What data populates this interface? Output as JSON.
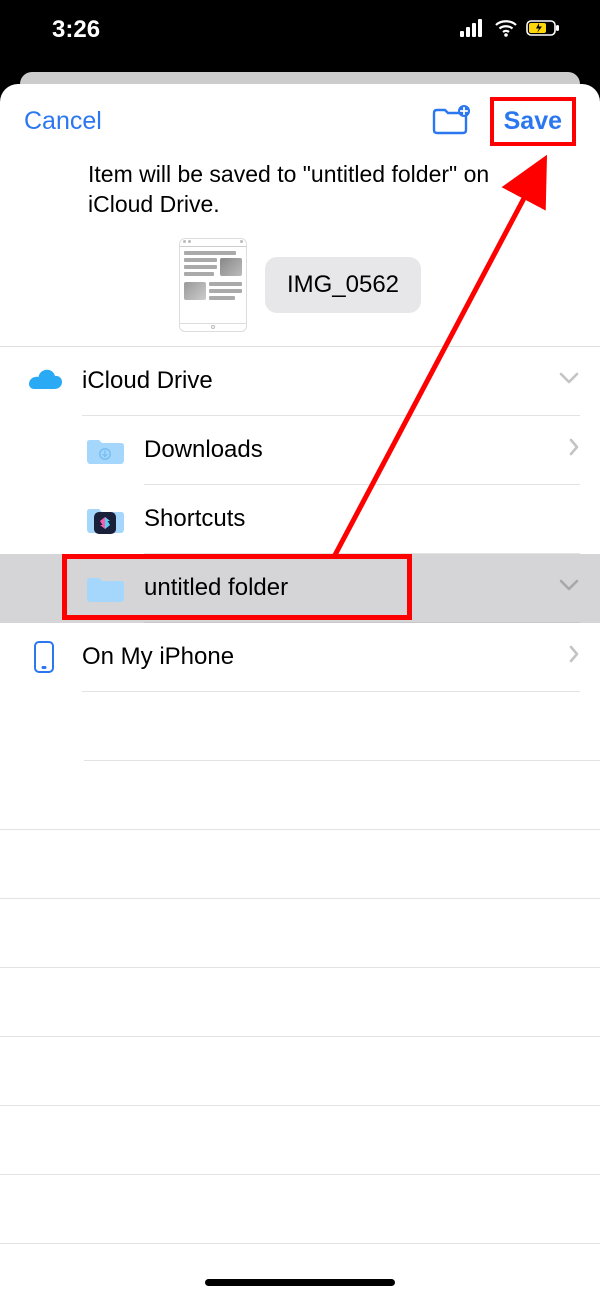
{
  "status": {
    "time": "3:26"
  },
  "header": {
    "cancel": "Cancel",
    "save": "Save"
  },
  "info_text": "Item will be saved to \"untitled folder\" on iCloud Drive.",
  "file": {
    "name": "IMG_0562"
  },
  "locations": {
    "icloud": "iCloud Drive",
    "downloads": "Downloads",
    "shortcuts": "Shortcuts",
    "untitled": "untitled folder",
    "iphone": "On My iPhone"
  }
}
